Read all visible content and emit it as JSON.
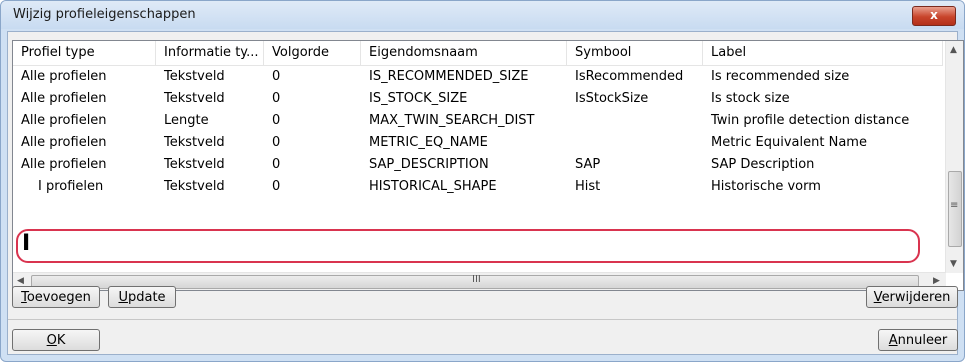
{
  "window": {
    "title": "Wijzig profieleigenschappen",
    "close_label": "x"
  },
  "table": {
    "columns": [
      "Profiel type",
      "Informatie ty...",
      "Volgorde",
      "Eigendomsnaam",
      "Symbool",
      "Label"
    ],
    "rows": [
      [
        "Alle profielen",
        "Tekstveld",
        "0",
        "IS_RECOMMENDED_SIZE",
        "IsRecommended",
        "Is recommended size"
      ],
      [
        "Alle profielen",
        "Tekstveld",
        "0",
        "IS_STOCK_SIZE",
        "IsStockSize",
        "Is stock size"
      ],
      [
        "Alle profielen",
        "Lengte",
        "0",
        "MAX_TWIN_SEARCH_DIST",
        "",
        "Twin profile detection distance"
      ],
      [
        "Alle profielen",
        "Tekstveld",
        "0",
        "METRIC_EQ_NAME",
        "",
        "Metric Equivalent Name"
      ],
      [
        "Alle profielen",
        "Tekstveld",
        "0",
        "SAP_DESCRIPTION",
        "SAP",
        "SAP Description"
      ],
      [
        "I profielen",
        "Tekstveld",
        "0",
        "HISTORICAL_SHAPE",
        "Hist",
        "Historische vorm"
      ]
    ],
    "highlight_color": "#d9344f"
  },
  "scrollbars": {
    "h_grip": "III",
    "v_grip": "≡"
  },
  "buttons": {
    "add": {
      "mnemonic": "T",
      "rest": "oevoegen"
    },
    "update": {
      "mnemonic": "U",
      "rest": "pdate"
    },
    "delete": {
      "mnemonic": "V",
      "rest": "erwijderen"
    },
    "ok": {
      "mnemonic": "O",
      "rest": "K"
    },
    "cancel": {
      "mnemonic": "A",
      "rest": "nnuleer"
    }
  },
  "cursor": {
    "icon": "text-ibeam-icon",
    "glyph": "I"
  }
}
